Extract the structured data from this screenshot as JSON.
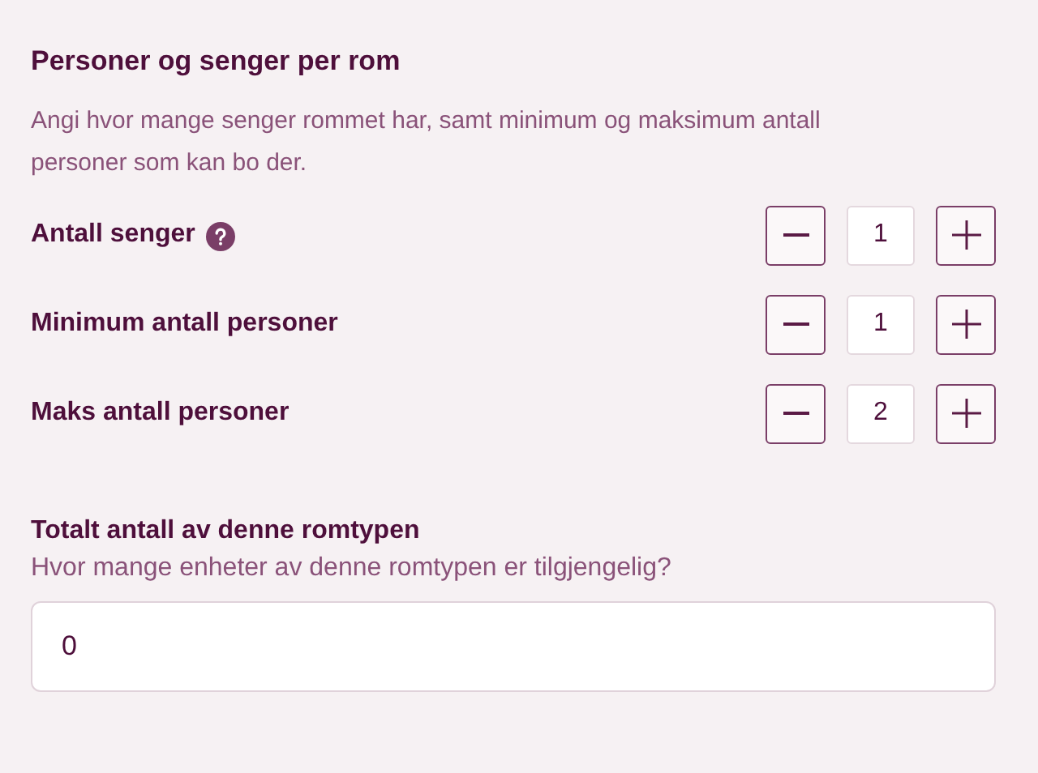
{
  "section": {
    "title": "Personer og senger per rom",
    "description": "Angi hvor mange senger rommet har, samt minimum og maksimum antall personer som kan bo der."
  },
  "steppers": [
    {
      "label": "Antall senger",
      "help": true,
      "value": "1"
    },
    {
      "label": "Minimum antall personer",
      "help": false,
      "value": "1"
    },
    {
      "label": "Maks antall personer",
      "help": false,
      "value": "2"
    }
  ],
  "total": {
    "title": "Totalt antall av denne romtypen",
    "hint": "Hvor mange enheter av denne romtypen er tilgjengelig?",
    "value": "0"
  }
}
